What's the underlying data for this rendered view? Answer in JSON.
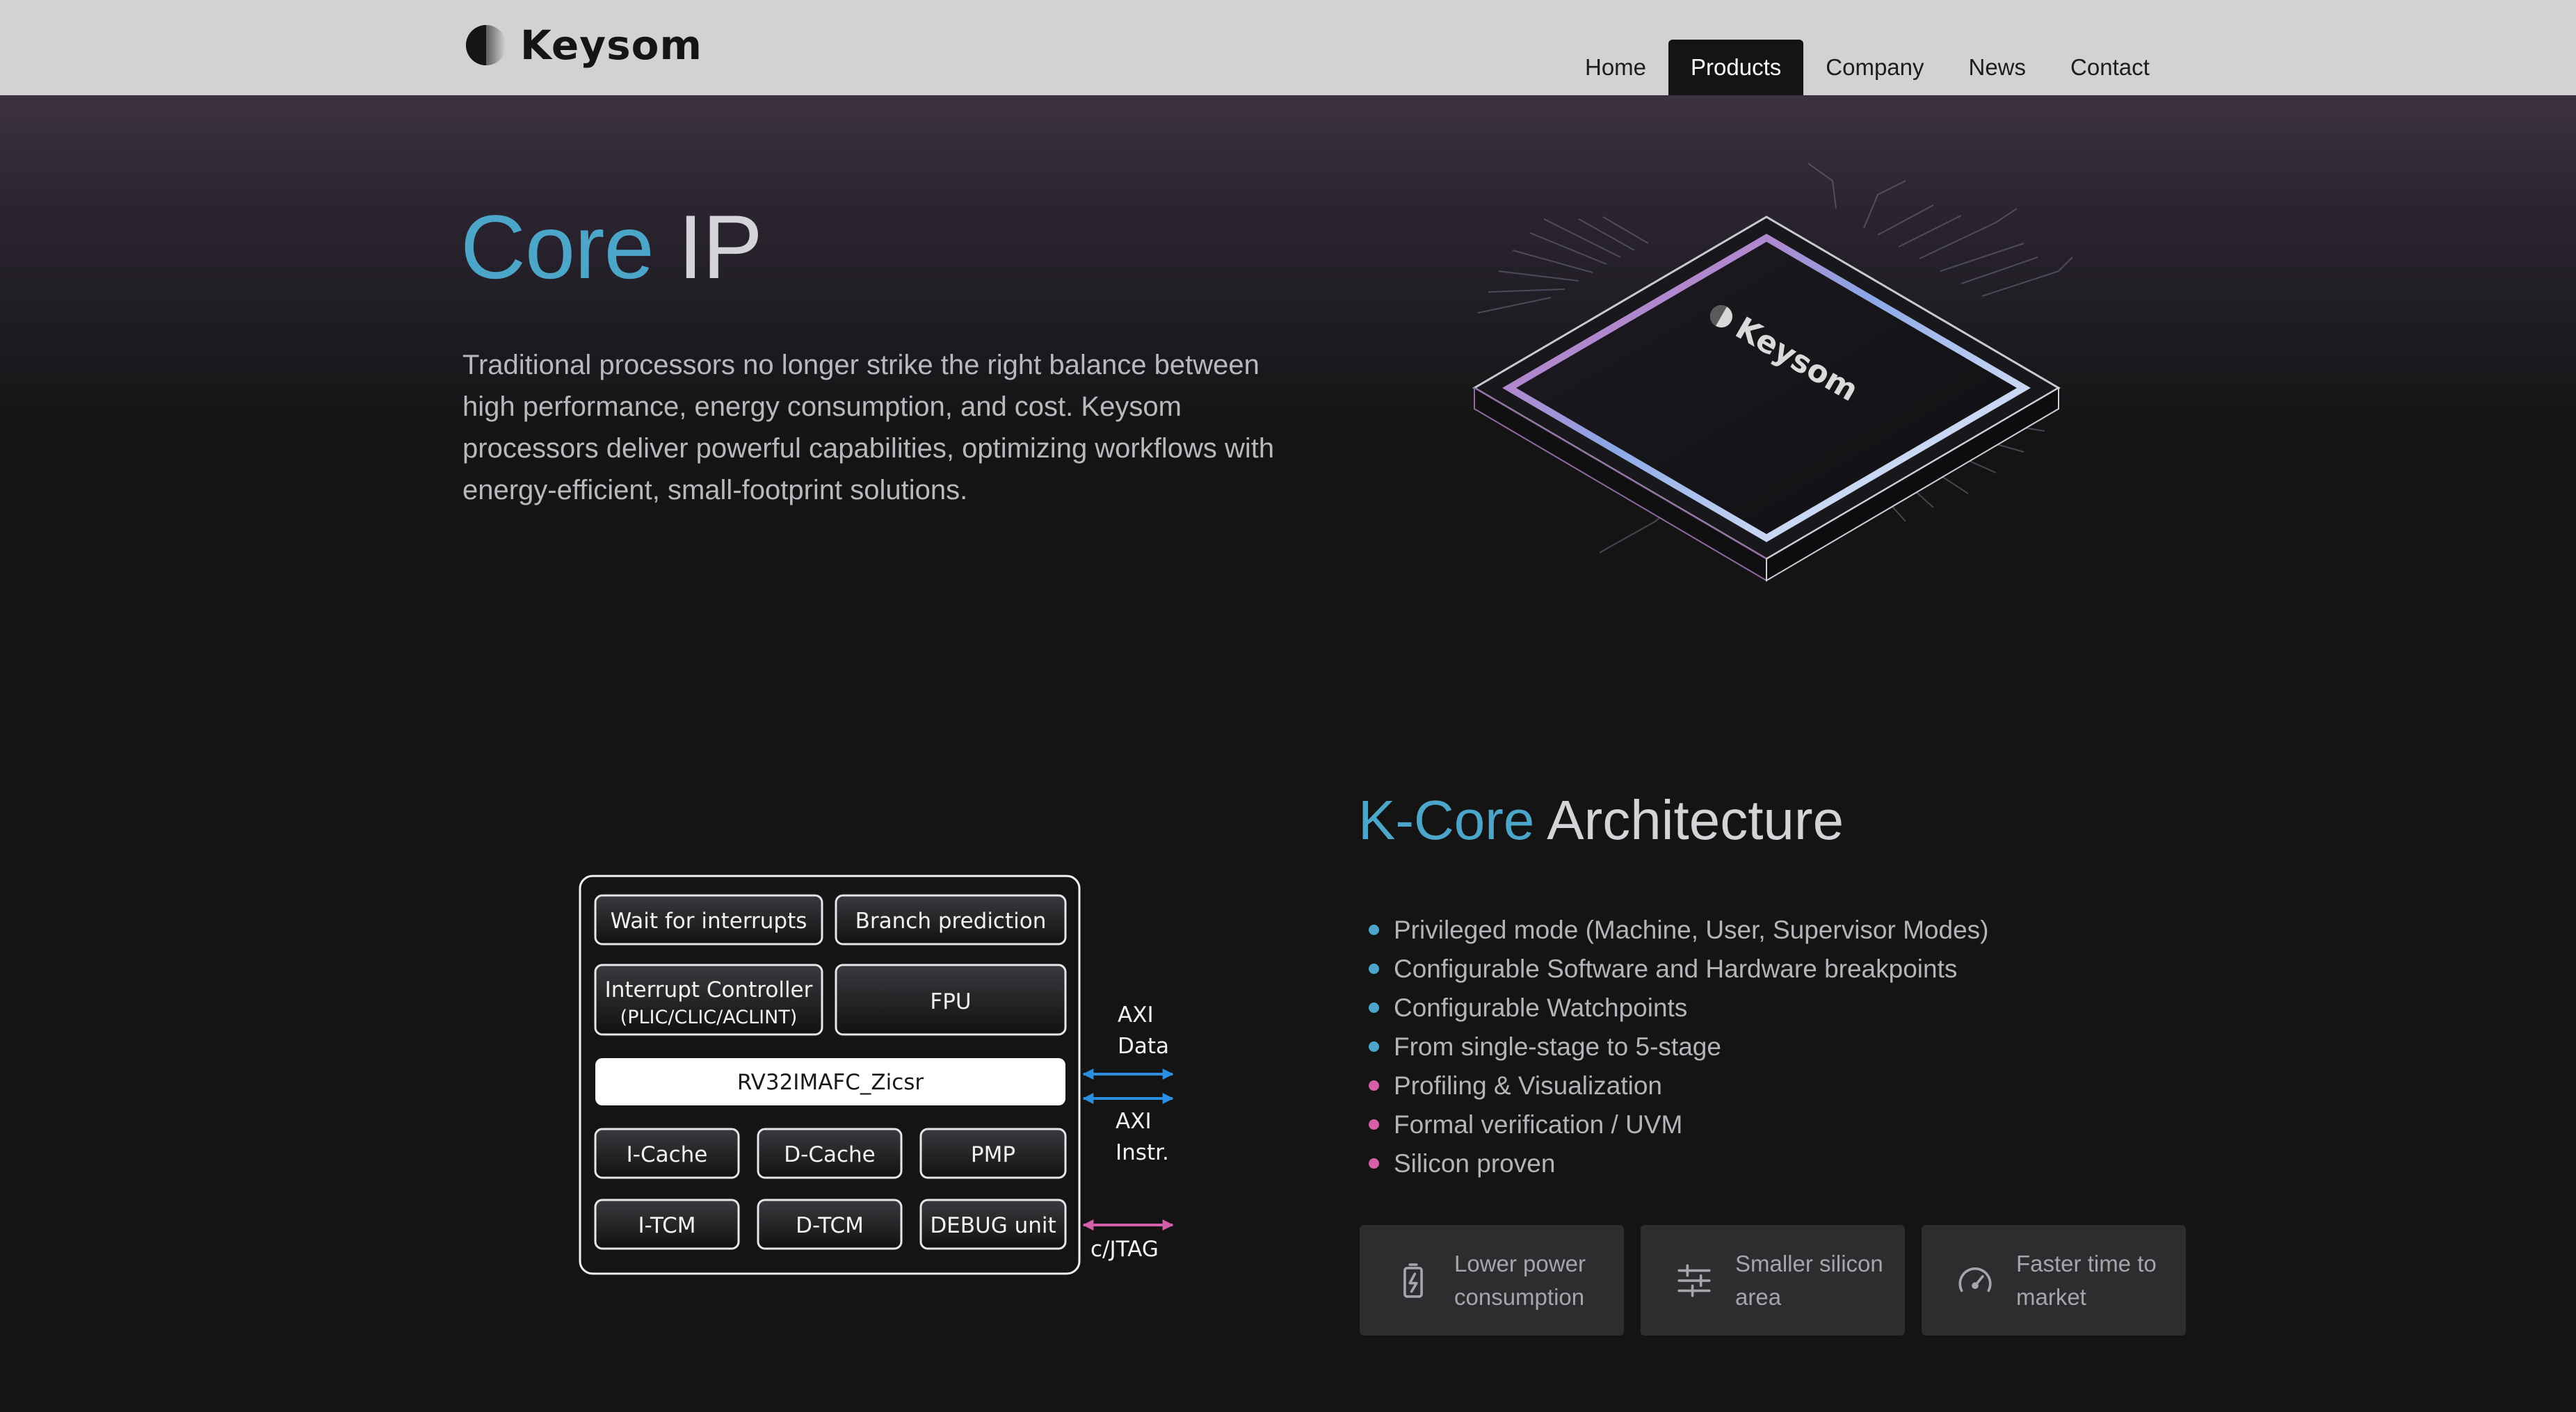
{
  "brand": {
    "name": "Keysom"
  },
  "nav": {
    "items": [
      {
        "label": "Home",
        "active": false
      },
      {
        "label": "Products",
        "active": true
      },
      {
        "label": "Company",
        "active": false
      },
      {
        "label": "News",
        "active": false
      },
      {
        "label": "Contact",
        "active": false
      }
    ]
  },
  "hero": {
    "title_accent": "Core",
    "title_rest": " IP",
    "description": "Traditional processors no longer strike the right balance between high performance, energy consumption, and cost. Keysom processors deliver powerful capabilities, optimizing workflows with energy-efficient, small-footprint solutions.",
    "chip_brand": "Keysom"
  },
  "diagram": {
    "wfi": "Wait for interrupts",
    "branch": "Branch prediction",
    "irq_line1": "Interrupt Controller",
    "irq_line2": "(PLIC/CLIC/ACLINT)",
    "fpu": "FPU",
    "isa": "RV32IMAFC_Zicsr",
    "icache": "I-Cache",
    "dcache": "D-Cache",
    "pmp": "PMP",
    "itcm": "I-TCM",
    "dtcm": "D-TCM",
    "debug": "DEBUG unit",
    "axi_data_1": "AXI",
    "axi_data_2": "Data",
    "axi_instr_1": "AXI",
    "axi_instr_2": "Instr.",
    "jtag": "c/JTAG"
  },
  "architecture": {
    "title_accent": "K-Core",
    "title_rest": " Architecture",
    "features": [
      {
        "text": "Privileged mode (Machine, User, Supervisor Modes)",
        "color": "#4ca6c9"
      },
      {
        "text": "Configurable Software and Hardware breakpoints",
        "color": "#4ca6c9"
      },
      {
        "text": "Configurable Watchpoints",
        "color": "#4ca6c9"
      },
      {
        "text": "From single-stage to 5-stage",
        "color": "#4ca6c9"
      },
      {
        "text": "Profiling & Visualization",
        "color": "#d25fa8"
      },
      {
        "text": "Formal verification / UVM",
        "color": "#d25fa8"
      },
      {
        "text": "Silicon proven",
        "color": "#d25fa8"
      }
    ]
  },
  "benefits": [
    {
      "label": "Lower power consumption",
      "icon": "battery-charging-icon"
    },
    {
      "label": "Smaller silicon area",
      "icon": "sliders-icon"
    },
    {
      "label": "Faster time to market",
      "icon": "speedometer-icon"
    }
  ],
  "colors": {
    "accent": "#4ca6c9",
    "pink": "#d25fa8",
    "arrow_blue": "#2a8fe0"
  }
}
